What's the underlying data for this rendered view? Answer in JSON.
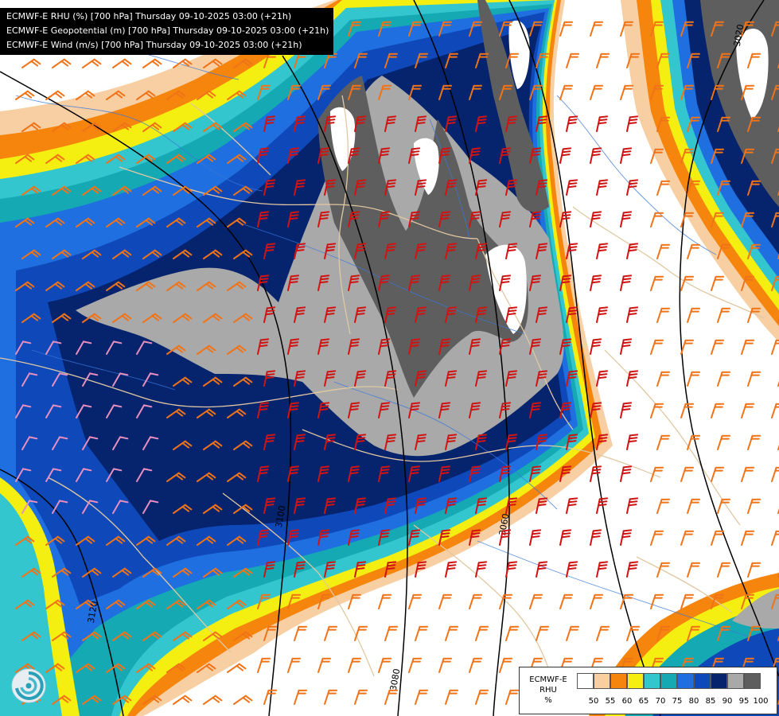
{
  "header": {
    "lines": [
      "ECMWF-E RHU (%) [700 hPa] Thursday 09-10-2025 03:00 (+21h)",
      "ECMWF-E Geopotential (m) [700 hPa] Thursday 09-10-2025 03:00 (+21h)",
      "ECMWF-E Wind (m/s) [700 hPa] Thursday 09-10-2025 03:00 (+21h)"
    ]
  },
  "legend": {
    "title": [
      "ECMWF-E",
      "RHU",
      "%"
    ],
    "levels": [
      "50",
      "55",
      "60",
      "65",
      "70",
      "75",
      "80",
      "85",
      "90",
      "95",
      "100"
    ],
    "colors": [
      "#ffffff",
      "#f7cfa3",
      "#f5850d",
      "#f4ee11",
      "#33c6cf",
      "#15a9b4",
      "#1f6fe0",
      "#0f48b8",
      "#06236e",
      "#a9a9a9",
      "#5e5e5e"
    ]
  },
  "contours": {
    "labels": [
      "3100",
      "3080",
      "3060",
      "3120",
      "3020"
    ],
    "line_color": "#000000"
  },
  "icons": {
    "logo": "ecmwf-swirl-logo-icon",
    "wind": "wind-barb-icon"
  },
  "colors": {
    "borders": "#e1c8a2",
    "rivers": "#3a78d8",
    "barb_slow": "#f07318",
    "barb_fast": "#d01414",
    "barb_calm": "#e890c0"
  }
}
